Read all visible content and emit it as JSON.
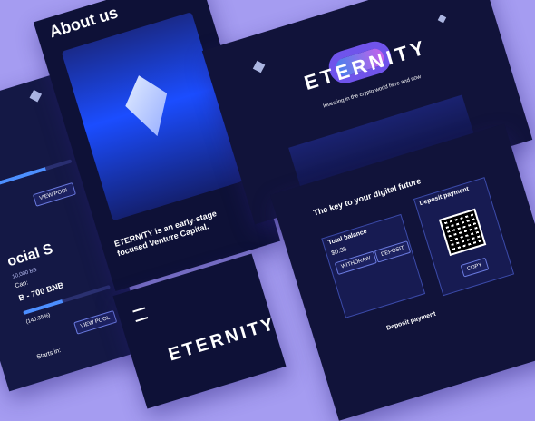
{
  "left_card": {
    "amount": "10,000 BB",
    "token_range": "B - 700 BNB",
    "percent": "(140.35%)",
    "view_pool": "VIEW POOL",
    "starts_in": "Starts in:",
    "title2": "ocial S",
    "cap_label": "Cap:",
    "progress_top": 0.7,
    "progress_bottom": 0.45
  },
  "about_card": {
    "title": "About us",
    "tagline": "ETERNITY is an early-stage focused Venture Capital."
  },
  "hero_card": {
    "brand": "ETERNITY",
    "subtitle": "Investing in the crypto world here and now"
  },
  "dashboard_card": {
    "heading": "The key to your digital future",
    "total_balance": "Total balance",
    "balance_value": "$0.35",
    "withdraw": "WITHDRAW",
    "deposit": "DEPOSIT",
    "deposit_payment": "Deposit payment",
    "deposit_payment_2": "Deposit payment",
    "copy": "COPY"
  },
  "bottom_card": {
    "brand": "ETERNITY"
  },
  "colors": {
    "background": "#a59cf1",
    "card": "#12143a",
    "accent_blue": "#4c8fff",
    "accent_pink": "#d76bff"
  }
}
